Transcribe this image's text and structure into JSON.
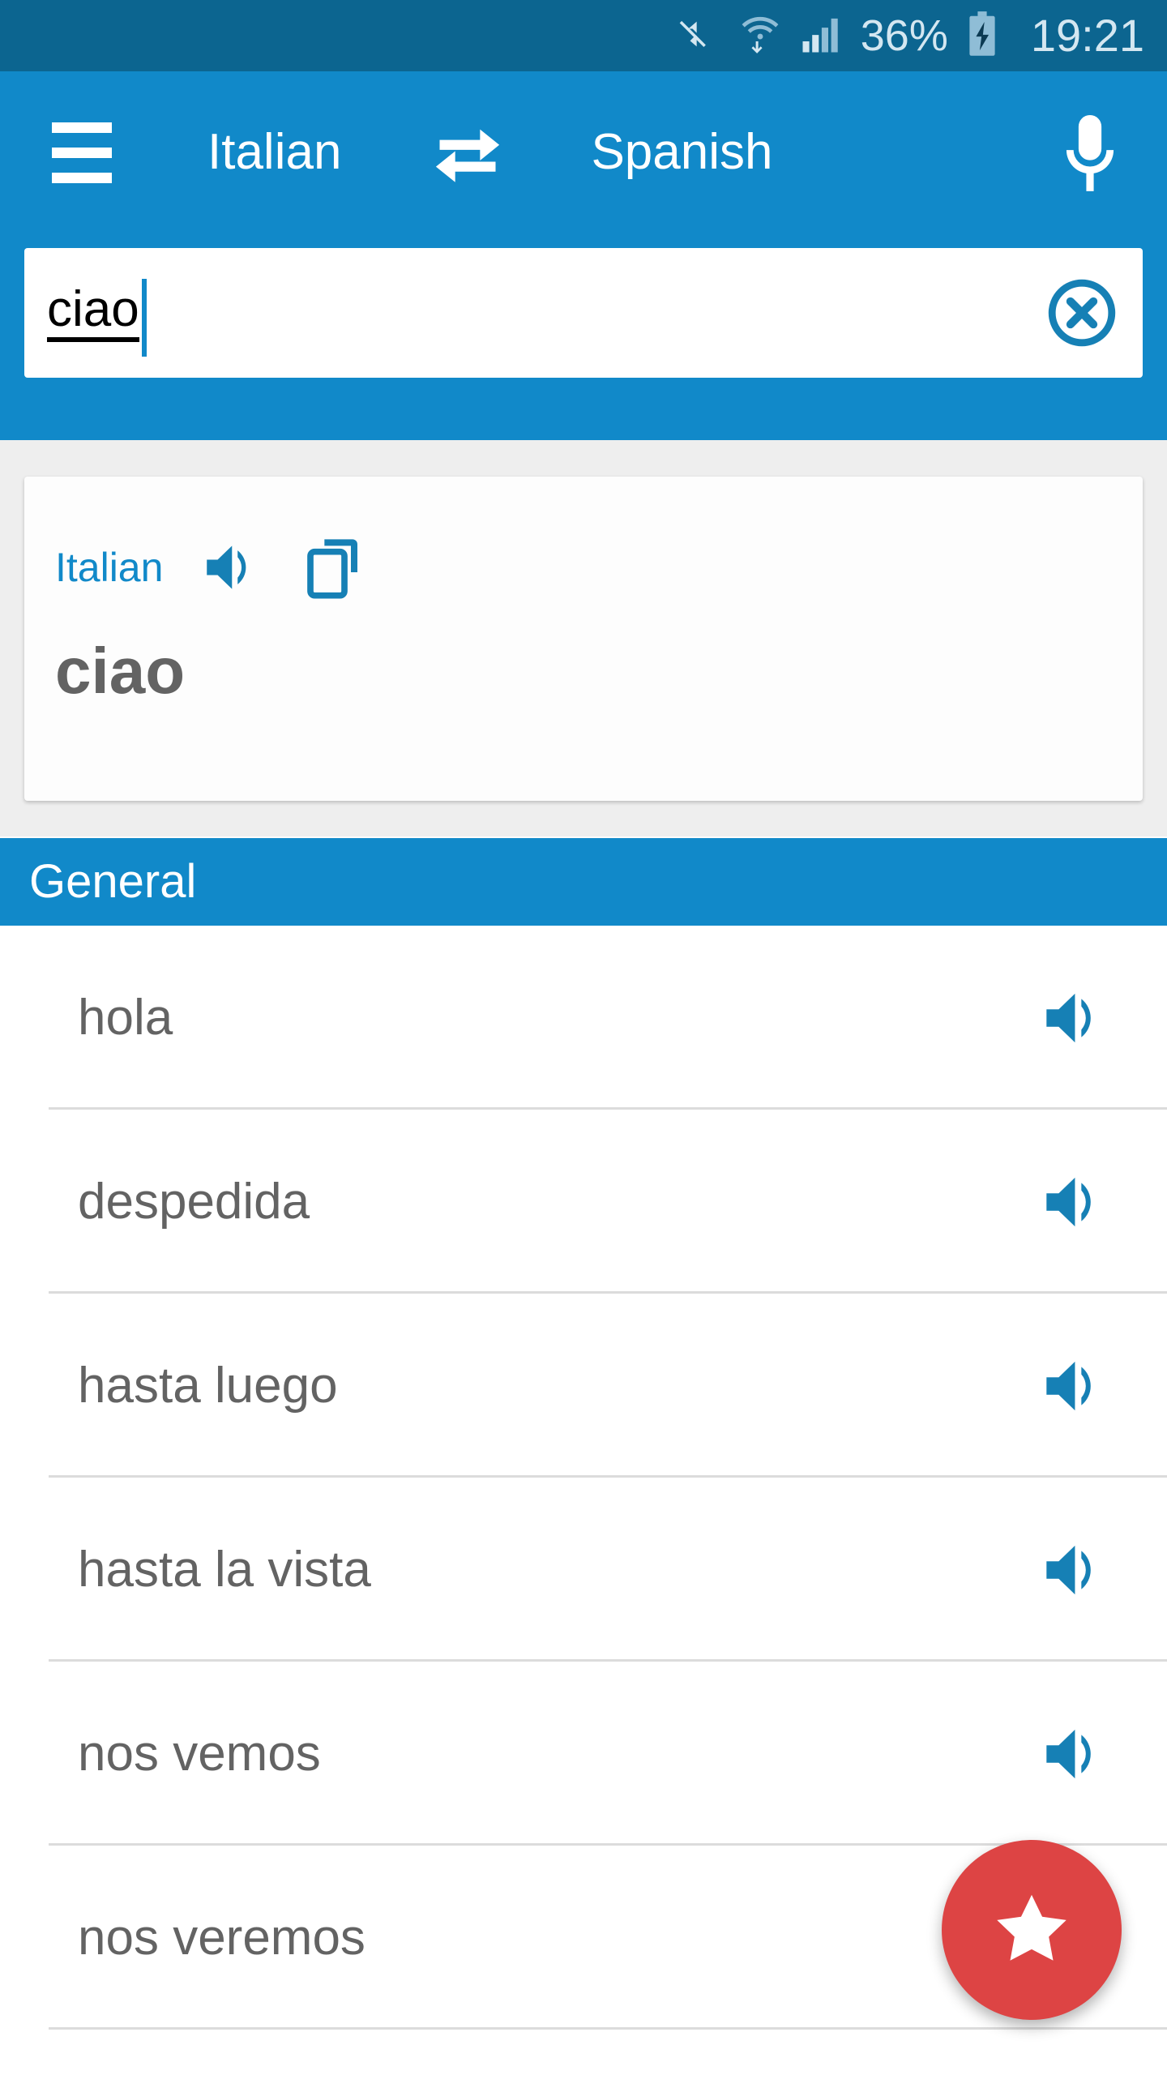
{
  "status_bar": {
    "battery_percent": "36%",
    "time": "19:21",
    "icons": [
      "mute-icon",
      "wifi-icon",
      "signal-icon",
      "battery-charging-icon"
    ],
    "background_color": "#0c6590",
    "text_color": "#d4e7f1"
  },
  "toolbar": {
    "menu_icon": "hamburger-menu-icon",
    "source_language": "Italian",
    "swap_icon": "swap-arrows-icon",
    "target_language": "Spanish",
    "mic_icon": "microphone-icon",
    "background_color": "#1189c9"
  },
  "search": {
    "value": "ciao",
    "placeholder": "",
    "clear_icon": "clear-circle-x-icon"
  },
  "result_card": {
    "language": "Italian",
    "speaker_icon": "speaker-icon",
    "copy_icon": "copy-icon",
    "word": "ciao",
    "accent_color": "#1189c9",
    "word_color": "#636363"
  },
  "section": {
    "title": "General",
    "background_color": "#1189c9"
  },
  "translations": [
    {
      "label": "hola",
      "speaker_icon": "speaker-icon"
    },
    {
      "label": "despedida",
      "speaker_icon": "speaker-icon"
    },
    {
      "label": "hasta luego",
      "speaker_icon": "speaker-icon"
    },
    {
      "label": "hasta la vista",
      "speaker_icon": "speaker-icon"
    },
    {
      "label": "nos vemos",
      "speaker_icon": "speaker-icon"
    },
    {
      "label": "nos veremos",
      "speaker_icon": "speaker-icon"
    }
  ],
  "fab": {
    "icon": "star-icon",
    "color": "#dd4444"
  }
}
